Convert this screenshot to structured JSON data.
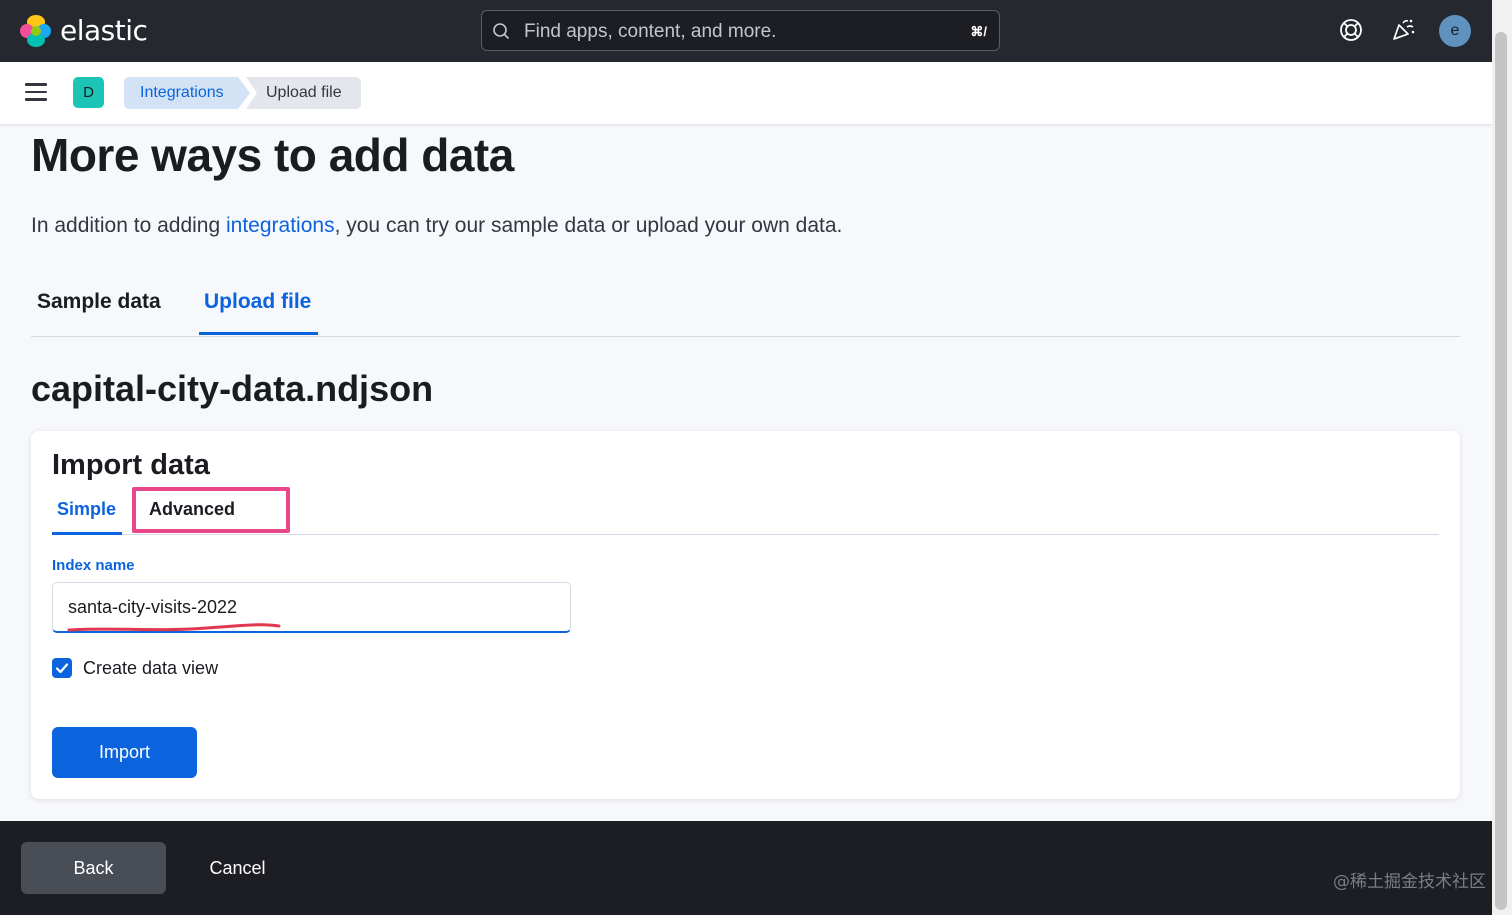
{
  "header": {
    "brand": "elastic",
    "search_placeholder": "Find apps, content, and more.",
    "search_shortcut": "⌘/",
    "avatar_initial": "e",
    "icons": [
      "help-icon",
      "newsfeed-icon"
    ]
  },
  "nav": {
    "space_initial": "D",
    "breadcrumbs": [
      {
        "label": "Integrations"
      },
      {
        "label": "Upload file"
      }
    ]
  },
  "page": {
    "title": "More ways to add data",
    "intro_before": "In addition to adding ",
    "intro_link": "integrations",
    "intro_after": ", you can try our sample data or upload your own data.",
    "tabs": [
      {
        "label": "Sample data",
        "active": false
      },
      {
        "label": "Upload file",
        "active": true
      }
    ],
    "file_name": "capital-city-data.ndjson"
  },
  "import_panel": {
    "title": "Import data",
    "tabs": [
      {
        "label": "Simple",
        "active": true
      },
      {
        "label": "Advanced",
        "active": false
      }
    ],
    "index_label": "Index name",
    "index_value": "santa-city-visits-2022",
    "create_view_label": "Create data view",
    "create_view_checked": true,
    "import_button": "Import"
  },
  "footer": {
    "back_button": "Back",
    "cancel_button": "Cancel",
    "watermark": "@稀土掘金技术社区"
  },
  "colors": {
    "accent": "#0b64dd",
    "highlight": "#e8478b",
    "header_bg": "#25282f",
    "footer_bg": "#1d1e24"
  }
}
